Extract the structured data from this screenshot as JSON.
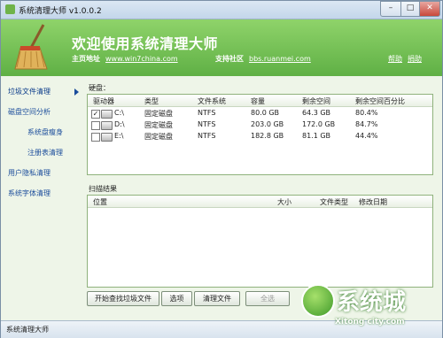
{
  "window": {
    "title": "系统清理大师 v1.0.0.2",
    "controls": {
      "minimize": "–",
      "maximize": "□",
      "close": "✕"
    }
  },
  "header": {
    "welcome": "欢迎使用系统清理大师",
    "homepage_label": "主页地址",
    "homepage_url": "www.win7china.com",
    "community_label": "支持社区",
    "community_url": "bbs.ruanmei.com",
    "help": "帮助",
    "donate": "捐助",
    "logo_icon": "broom-icon"
  },
  "sidebar": {
    "items": [
      {
        "label": "垃圾文件清理",
        "active": true
      },
      {
        "label": "磁盘空间分析"
      },
      {
        "label": "系统盘瘦身"
      },
      {
        "label": "注册表清理"
      },
      {
        "label": "用户隐私清理"
      },
      {
        "label": "系统字体清理"
      }
    ]
  },
  "disks": {
    "label": "硬盘：",
    "columns": [
      "驱动器",
      "类型",
      "文件系统",
      "容量",
      "剩余空间",
      "剩余空间百分比"
    ],
    "rows": [
      {
        "checked": true,
        "drive": "C:\\",
        "type": "固定磁盘",
        "fs": "NTFS",
        "capacity": "80.0 GB",
        "free": "64.3 GB",
        "pct": "80.4%"
      },
      {
        "checked": false,
        "drive": "D:\\",
        "type": "固定磁盘",
        "fs": "NTFS",
        "capacity": "203.0 GB",
        "free": "172.0 GB",
        "pct": "84.7%"
      },
      {
        "checked": false,
        "drive": "E:\\",
        "type": "固定磁盘",
        "fs": "NTFS",
        "capacity": "182.8 GB",
        "free": "81.1 GB",
        "pct": "44.4%"
      }
    ]
  },
  "results": {
    "label": "扫描结果",
    "columns": [
      "位置",
      "大小",
      "文件类型",
      "修改日期"
    ]
  },
  "buttons": {
    "start_scan": "开始查找垃圾文件",
    "options": "选项",
    "clean": "清理文件",
    "select_all": "全选"
  },
  "statusbar": {
    "text": "系统清理大师"
  },
  "watermark": {
    "big": "系统城",
    "small": "Xitong city.com"
  },
  "colors": {
    "header_green": "#6dbd4f",
    "nav_blue": "#1a4c9b"
  }
}
